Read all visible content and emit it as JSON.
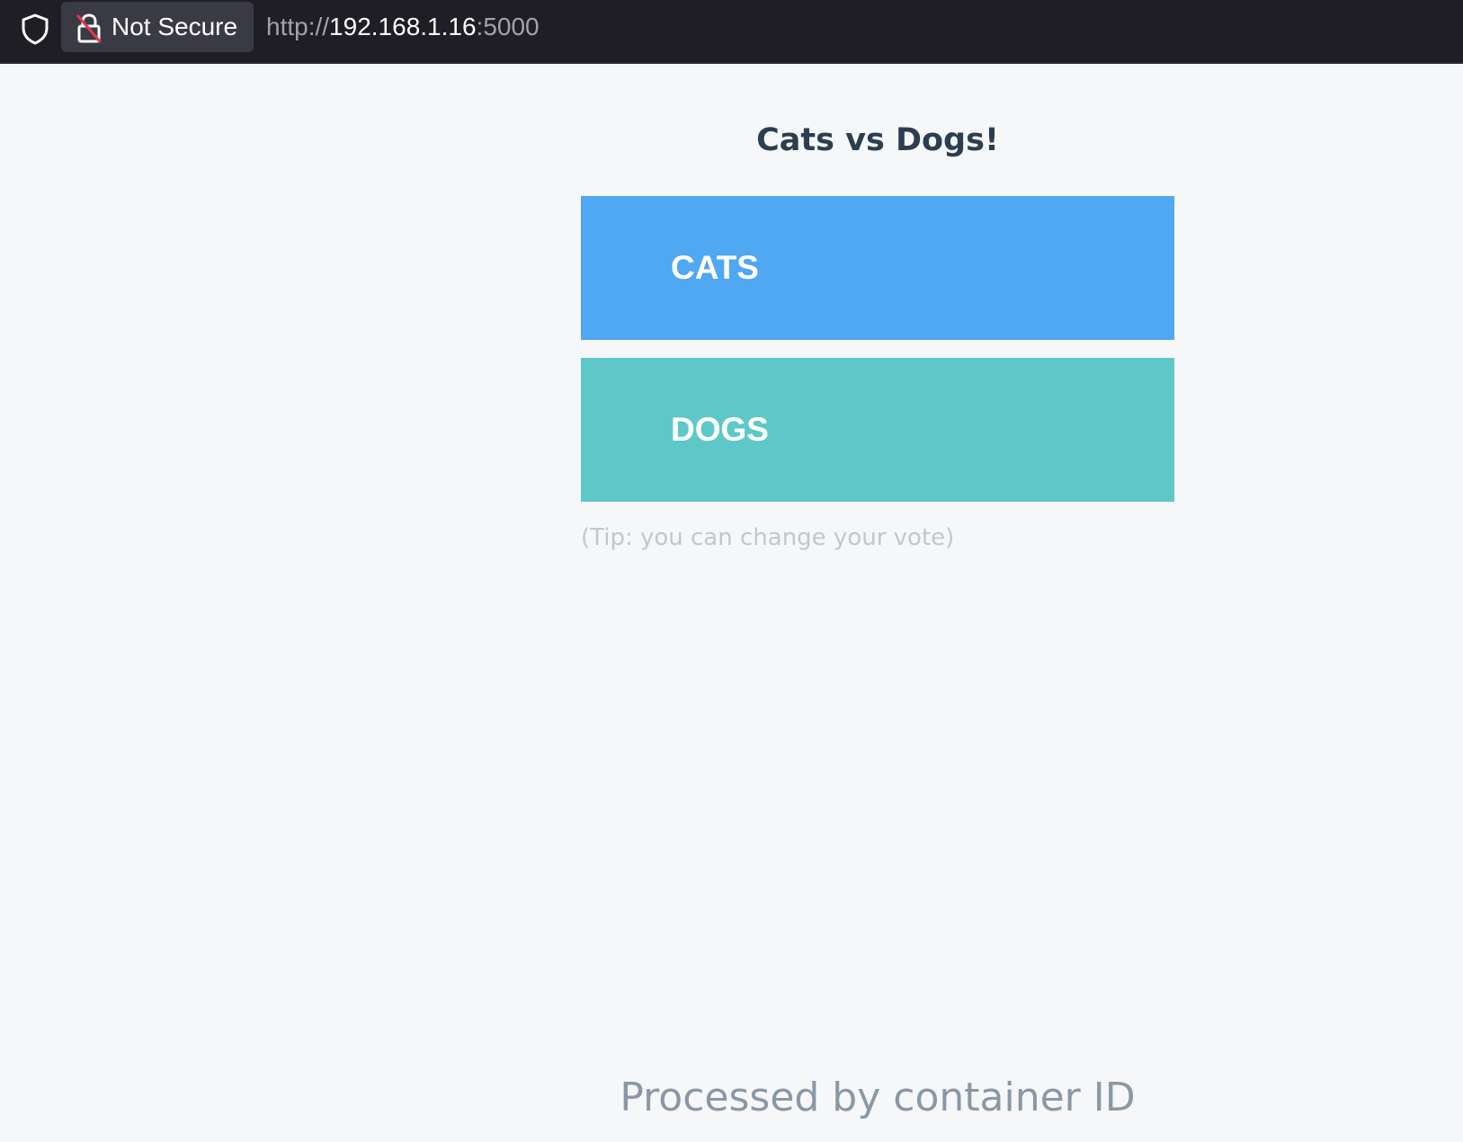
{
  "browser": {
    "security_label": "Not Secure",
    "url": {
      "scheme": "http://",
      "host": "192.168.1.16",
      "port": ":5000"
    },
    "icons": {
      "tracking_protection": "shield-icon",
      "insecure_lock": "lock-insecure-icon"
    }
  },
  "page": {
    "title": "Cats vs Dogs!",
    "options": [
      {
        "label": "CATS",
        "color": "#50a7f2"
      },
      {
        "label": "DOGS",
        "color": "#5ec8c8"
      }
    ],
    "tip": "(Tip: you can change your vote)",
    "footer": "Processed by container ID"
  },
  "colors": {
    "page_background": "#f6f7f9",
    "title": "#2c3e50",
    "tip": "#c3c7cc",
    "footer": "#8a98a6",
    "chrome_background": "#1e1e24"
  }
}
